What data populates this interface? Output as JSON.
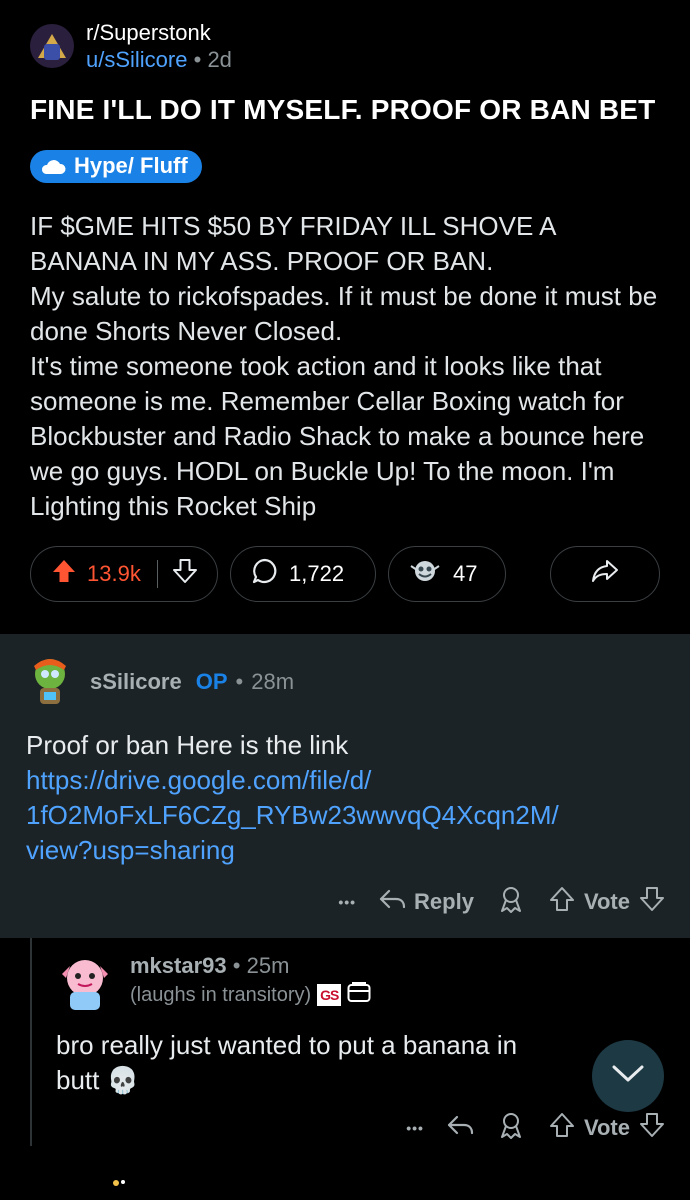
{
  "post": {
    "subreddit": "r/Superstonk",
    "author": "u/sSilicore",
    "age": "2d",
    "separator": "•",
    "title": "FINE I'LL DO IT MYSELF. PROOF OR BAN BET",
    "flair": "Hype/ Fluff",
    "body": "IF $GME HITS $50 BY FRIDAY ILL SHOVE A BANANA IN MY ASS. PROOF OR BAN.\nMy salute to rickofspades. If it must be done it must be done Shorts Never Closed.\nIt's time someone took action and it looks like that someone is me. Remember Cellar Boxing watch for Blockbuster and Radio Shack to make a bounce here we go guys. HODL on Buckle Up! To the moon. I'm Lighting this Rocket Ship",
    "votes": "13.9k",
    "comments": "1,722",
    "awards": "47"
  },
  "op_comment": {
    "author": "sSilicore",
    "op_tag": "OP",
    "separator": "•",
    "age": "28m",
    "text": "Proof or ban Here is the link",
    "link_line1": "https://drive.google.com/file/d/",
    "link_line2": "1fO2MoFxLF6CZg_RYBw23wwvqQ4Xcqn2M/",
    "link_line3": "view?usp=sharing",
    "more": "•••",
    "reply_label": "Reply",
    "vote_label": "Vote"
  },
  "reply_comment": {
    "author": "mkstar93",
    "separator": "•",
    "age": "25m",
    "flair_text": "(laughs in transitory)",
    "gs_badge": "GS",
    "text": "bro really just wanted to put a banana in",
    "text_line2": "butt",
    "emoji": "💀",
    "more": "•••",
    "vote_label": "Vote"
  },
  "colors": {
    "background": "#000000",
    "comment_bg": "#1c2326",
    "link": "#4fa3ff",
    "upvote": "#ff5533",
    "flair": "#1a82e6"
  }
}
